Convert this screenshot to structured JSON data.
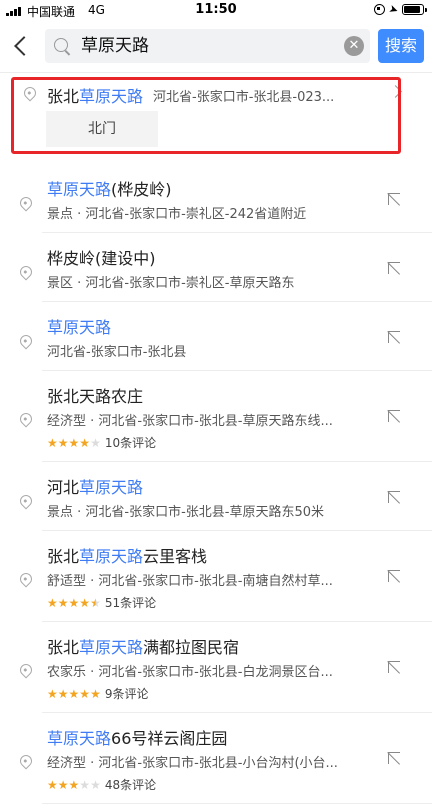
{
  "status_bar": {
    "carrier": "中国联通",
    "network": "4G",
    "time": "11:50",
    "battery_level": 0.9
  },
  "search": {
    "query": "草原天路",
    "button_label": "搜索"
  },
  "first_result": {
    "title_prefix": "张北",
    "title_highlight": "草原天路",
    "address": "河北省-张家口市-张北县-023...",
    "sub_poi": "北门"
  },
  "results": [
    {
      "title_pre": "",
      "title_hl": "草原天路",
      "title_post": "(桦皮岭)",
      "sub": "景点 · 河北省-张家口市-崇礼区-242省道附近",
      "rating": null
    },
    {
      "title_pre": "桦皮岭(建设中)",
      "title_hl": "",
      "title_post": "",
      "sub": "景区 · 河北省-张家口市-崇礼区-草原天路东",
      "rating": null
    },
    {
      "title_pre": "",
      "title_hl": "草原天路",
      "title_post": "",
      "sub": "河北省-张家口市-张北县",
      "rating": null
    },
    {
      "title_pre": "张北天路农庄",
      "title_hl": "",
      "title_post": "",
      "sub": "经济型 · 河北省-张家口市-张北县-草原天路东线...",
      "rating": 4,
      "reviews": "10条评论"
    },
    {
      "title_pre": "河北",
      "title_hl": "草原天路",
      "title_post": "",
      "sub": "景点 · 河北省-张家口市-张北县-草原天路东50米",
      "rating": null
    },
    {
      "title_pre": "张北",
      "title_hl": "草原天路",
      "title_post": "云里客栈",
      "sub": "舒适型 · 河北省-张家口市-张北县-南塘自然村草...",
      "rating": 4.5,
      "reviews": "51条评论"
    },
    {
      "title_pre": "张北",
      "title_hl": "草原天路",
      "title_post": "满都拉图民宿",
      "sub": "农家乐 · 河北省-张家口市-张北县-白龙洞景区台...",
      "rating": 5,
      "reviews": "9条评论"
    },
    {
      "title_pre": "",
      "title_hl": "草原天路",
      "title_post": "66号祥云阁庄园",
      "sub": "经济型 · 河北省-张家口市-张北县-小台沟村(小台...",
      "rating": 3,
      "reviews": "48条评论"
    }
  ],
  "colors": {
    "accent": "#3f8cff",
    "highlight_text": "#3f7cf4",
    "annotation_box": "#e8262a",
    "star": "#f3a521"
  }
}
